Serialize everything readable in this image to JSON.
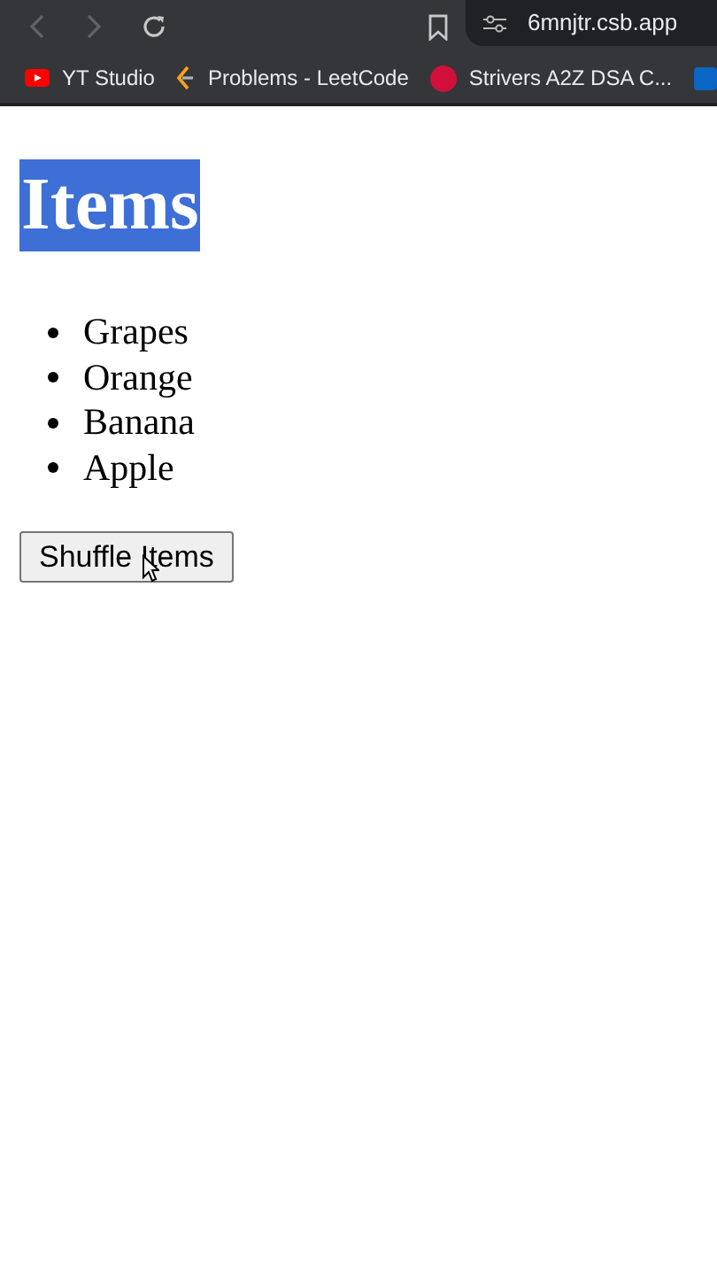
{
  "browser": {
    "address": "6mnjtr.csb.app",
    "bookmarks": [
      {
        "kind": "youtube",
        "label": "YT Studio"
      },
      {
        "kind": "leetcode",
        "label": "Problems - LeetCode"
      },
      {
        "kind": "tuf",
        "label": "Strivers A2Z DSA C..."
      },
      {
        "kind": "linkedin"
      }
    ]
  },
  "page": {
    "heading": {
      "text": "Items",
      "selected": true
    },
    "items": [
      "Grapes",
      "Orange",
      "Banana",
      "Apple"
    ],
    "button": "Shuffle Items"
  }
}
